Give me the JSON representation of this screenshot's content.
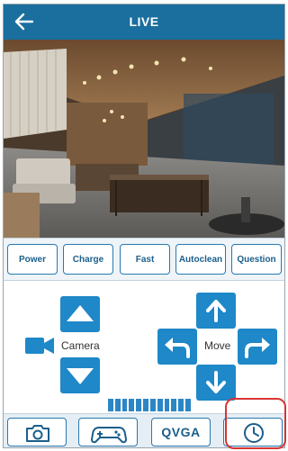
{
  "header": {
    "title": "LIVE",
    "back_icon": "back-arrow-icon"
  },
  "commands": [
    {
      "label": "Power"
    },
    {
      "label": "Charge"
    },
    {
      "label": "Fast"
    },
    {
      "label": "Autoclean"
    },
    {
      "label": "Question"
    }
  ],
  "controls": {
    "camera_label": "Camera",
    "move_label": "Move",
    "camera_icon": "video-camera-icon",
    "level_bars": 12
  },
  "bottom": {
    "snapshot_icon": "camera-icon",
    "gamepad_icon": "gamepad-icon",
    "resolution_label": "QVGA",
    "clock_icon": "clock-icon"
  },
  "colors": {
    "header": "#1a6f9e",
    "accent": "#1e88c8",
    "button_border": "#2779b0",
    "highlight": "#d93434"
  }
}
